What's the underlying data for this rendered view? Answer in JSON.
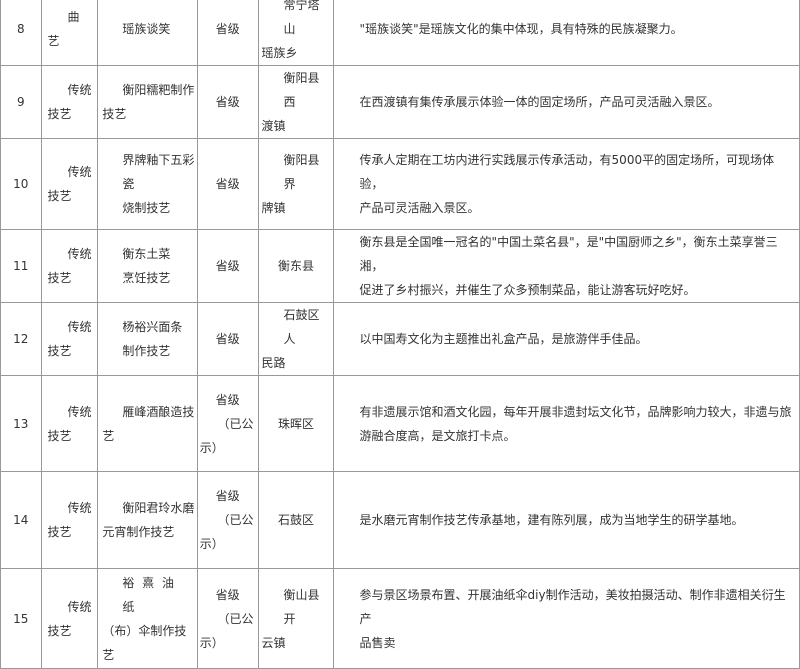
{
  "rows": [
    {
      "no": "8",
      "cat1": "曲",
      "cat2": "艺",
      "name1": "瑶族谈笑",
      "name2": "",
      "level": "省级",
      "loc1": "常宁塔山",
      "loc2": "瑶族乡",
      "desc1": "\"瑶族谈笑\"是瑶族文化的集中体现，具有特殊的民族凝聚力。",
      "desc2": ""
    },
    {
      "no": "9",
      "cat1": "传统",
      "cat2": "技艺",
      "name1": "衡阳糯粑制作",
      "name2": "技艺",
      "level": "省级",
      "loc1": "衡阳县西",
      "loc2": "渡镇",
      "desc1": "在西渡镇有集传承展示体验一体的固定场所，产品可灵活融入景区。",
      "desc2": ""
    },
    {
      "no": "10",
      "cat1": "传统",
      "cat2": "技艺",
      "name1": "界牌釉下五彩",
      "name2": "瓷",
      "name3": "烧制技艺",
      "level": "省级",
      "loc1": "衡阳县界",
      "loc2": "牌镇",
      "desc1": "传承人定期在工坊内进行实践展示传承活动，有5000平的固定场所，可现场体验，",
      "desc2": "产品可灵活融入景区。"
    },
    {
      "no": "11",
      "cat1": "传统",
      "cat2": "技艺",
      "name1": "衡东土菜",
      "name2": "烹饪技艺",
      "level": "省级",
      "loc1": "衡东县",
      "loc2": "",
      "desc1": "衡东县是全国唯一冠名的\"中国土菜名县\"，是\"中国厨师之乡\"，衡东土菜享誉三湘，",
      "desc2": "促进了乡村振兴，并催生了众多预制菜品，能让游客玩好吃好。"
    },
    {
      "no": "12",
      "cat1": "传统",
      "cat2": "技艺",
      "name1": "杨裕兴面条",
      "name2": "制作技艺",
      "level": "省级",
      "loc1": "石鼓区人",
      "loc2": "民路",
      "desc1": "以中国寿文化为主题推出礼盒产品，是旅游伴手佳品。",
      "desc2": ""
    },
    {
      "no": "13",
      "cat1": "传统",
      "cat2": "技艺",
      "name1": "雁峰酒酿造技",
      "name2": "艺",
      "level1": "省级",
      "level2": "（已公",
      "level3": "示）",
      "loc1": "珠晖区",
      "loc2": "",
      "desc1": "有非遗展示馆和酒文化园，每年开展非遗封坛文化节，品牌影响力较大，非遗与旅",
      "desc2": "游融合度高，是文旅打卡点。"
    },
    {
      "no": "14",
      "cat1": "传统",
      "cat2": "技艺",
      "name1": "衡阳君玲水磨",
      "name2": "元宵制作技艺",
      "level1": "省级",
      "level2": "（已公",
      "level3": "示）",
      "loc1": "石鼓区",
      "loc2": "",
      "desc1": "是水磨元宵制作技艺传承基地，建有陈列展，成为当地学生的研学基地。",
      "desc2": ""
    },
    {
      "no": "15",
      "cat1": "传统",
      "cat2": "技艺",
      "name1": "裕 熹 油 纸",
      "name2": "（布）伞制作技艺",
      "level1": "省级",
      "level2": "（已公",
      "level3": "示）",
      "loc1": "衡山县开",
      "loc2": "云镇",
      "desc1": "参与景区场景布置、开展油纸伞diy制作活动，美妆拍摄活动、制作非遗相关衍生产",
      "desc2": "品售卖"
    }
  ]
}
